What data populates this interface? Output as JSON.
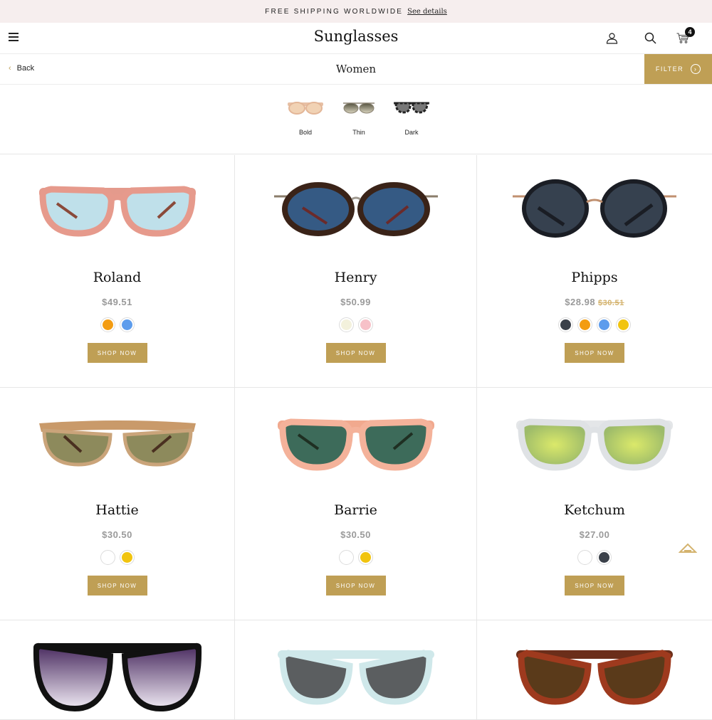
{
  "promo": {
    "text": "FREE SHIPPING WORLDWIDE",
    "link": "See details"
  },
  "header": {
    "logo": "Sunglasses",
    "cart_count": "4",
    "icons": [
      "menu-icon",
      "user-icon",
      "search-icon",
      "cart-icon"
    ]
  },
  "subbar": {
    "back": "Back",
    "title": "Women",
    "filter": "FILTER"
  },
  "styles": [
    {
      "label": "Bold"
    },
    {
      "label": "Thin"
    },
    {
      "label": "Dark"
    }
  ],
  "colors": {
    "accent": "#bf9f55",
    "price": "#9a9a9a"
  },
  "products": [
    {
      "name": "Roland",
      "price": "$49.51",
      "old_price": "",
      "swatches": [
        "#f39c12",
        "#5d9cec"
      ],
      "button": "SHOP NOW"
    },
    {
      "name": "Henry",
      "price": "$50.99",
      "old_price": "",
      "swatches": [
        "#f3f1dc",
        "#f7c1c8"
      ],
      "button": "SHOP NOW"
    },
    {
      "name": "Phipps",
      "price": "$28.98",
      "old_price": "$30.51",
      "swatches": [
        "#3b414a",
        "#f39c12",
        "#5d9cec",
        "#f1c40f"
      ],
      "button": "SHOP NOW"
    },
    {
      "name": "Hattie",
      "price": "$30.50",
      "old_price": "",
      "swatches": [
        "#ffffff",
        "#f1c40f"
      ],
      "button": "SHOP NOW"
    },
    {
      "name": "Barrie",
      "price": "$30.50",
      "old_price": "",
      "swatches": [
        "#ffffff",
        "#f1c40f"
      ],
      "button": "SHOP NOW"
    },
    {
      "name": "Ketchum",
      "price": "$27.00",
      "old_price": "",
      "swatches": [
        "#ffffff",
        "#3b414a"
      ],
      "button": "SHOP NOW"
    }
  ]
}
